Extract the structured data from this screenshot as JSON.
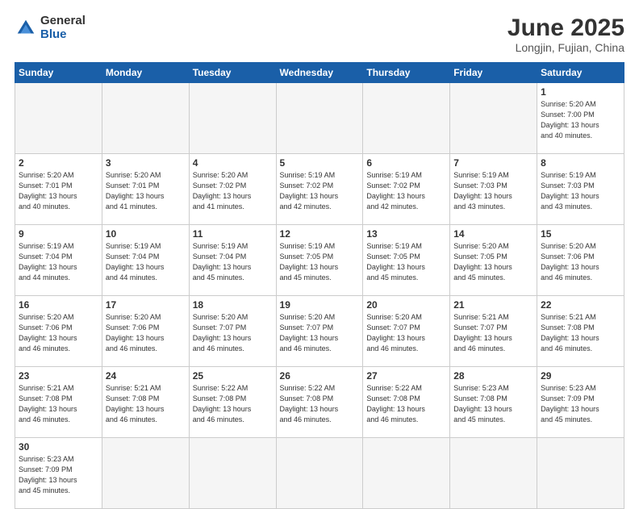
{
  "logo": {
    "general": "General",
    "blue": "Blue"
  },
  "title": "June 2025",
  "subtitle": "Longjin, Fujian, China",
  "headers": [
    "Sunday",
    "Monday",
    "Tuesday",
    "Wednesday",
    "Thursday",
    "Friday",
    "Saturday"
  ],
  "days": [
    {
      "num": "",
      "info": ""
    },
    {
      "num": "",
      "info": ""
    },
    {
      "num": "",
      "info": ""
    },
    {
      "num": "",
      "info": ""
    },
    {
      "num": "",
      "info": ""
    },
    {
      "num": "",
      "info": ""
    },
    {
      "num": "1",
      "info": "Sunrise: 5:20 AM\nSunset: 7:00 PM\nDaylight: 13 hours\nand 40 minutes."
    },
    {
      "num": "2",
      "info": "Sunrise: 5:20 AM\nSunset: 7:01 PM\nDaylight: 13 hours\nand 40 minutes."
    },
    {
      "num": "3",
      "info": "Sunrise: 5:20 AM\nSunset: 7:01 PM\nDaylight: 13 hours\nand 41 minutes."
    },
    {
      "num": "4",
      "info": "Sunrise: 5:20 AM\nSunset: 7:02 PM\nDaylight: 13 hours\nand 41 minutes."
    },
    {
      "num": "5",
      "info": "Sunrise: 5:19 AM\nSunset: 7:02 PM\nDaylight: 13 hours\nand 42 minutes."
    },
    {
      "num": "6",
      "info": "Sunrise: 5:19 AM\nSunset: 7:02 PM\nDaylight: 13 hours\nand 42 minutes."
    },
    {
      "num": "7",
      "info": "Sunrise: 5:19 AM\nSunset: 7:03 PM\nDaylight: 13 hours\nand 43 minutes."
    },
    {
      "num": "8",
      "info": "Sunrise: 5:19 AM\nSunset: 7:03 PM\nDaylight: 13 hours\nand 43 minutes."
    },
    {
      "num": "9",
      "info": "Sunrise: 5:19 AM\nSunset: 7:04 PM\nDaylight: 13 hours\nand 44 minutes."
    },
    {
      "num": "10",
      "info": "Sunrise: 5:19 AM\nSunset: 7:04 PM\nDaylight: 13 hours\nand 44 minutes."
    },
    {
      "num": "11",
      "info": "Sunrise: 5:19 AM\nSunset: 7:04 PM\nDaylight: 13 hours\nand 45 minutes."
    },
    {
      "num": "12",
      "info": "Sunrise: 5:19 AM\nSunset: 7:05 PM\nDaylight: 13 hours\nand 45 minutes."
    },
    {
      "num": "13",
      "info": "Sunrise: 5:19 AM\nSunset: 7:05 PM\nDaylight: 13 hours\nand 45 minutes."
    },
    {
      "num": "14",
      "info": "Sunrise: 5:20 AM\nSunset: 7:05 PM\nDaylight: 13 hours\nand 45 minutes."
    },
    {
      "num": "15",
      "info": "Sunrise: 5:20 AM\nSunset: 7:06 PM\nDaylight: 13 hours\nand 46 minutes."
    },
    {
      "num": "16",
      "info": "Sunrise: 5:20 AM\nSunset: 7:06 PM\nDaylight: 13 hours\nand 46 minutes."
    },
    {
      "num": "17",
      "info": "Sunrise: 5:20 AM\nSunset: 7:06 PM\nDaylight: 13 hours\nand 46 minutes."
    },
    {
      "num": "18",
      "info": "Sunrise: 5:20 AM\nSunset: 7:07 PM\nDaylight: 13 hours\nand 46 minutes."
    },
    {
      "num": "19",
      "info": "Sunrise: 5:20 AM\nSunset: 7:07 PM\nDaylight: 13 hours\nand 46 minutes."
    },
    {
      "num": "20",
      "info": "Sunrise: 5:20 AM\nSunset: 7:07 PM\nDaylight: 13 hours\nand 46 minutes."
    },
    {
      "num": "21",
      "info": "Sunrise: 5:21 AM\nSunset: 7:07 PM\nDaylight: 13 hours\nand 46 minutes."
    },
    {
      "num": "22",
      "info": "Sunrise: 5:21 AM\nSunset: 7:08 PM\nDaylight: 13 hours\nand 46 minutes."
    },
    {
      "num": "23",
      "info": "Sunrise: 5:21 AM\nSunset: 7:08 PM\nDaylight: 13 hours\nand 46 minutes."
    },
    {
      "num": "24",
      "info": "Sunrise: 5:21 AM\nSunset: 7:08 PM\nDaylight: 13 hours\nand 46 minutes."
    },
    {
      "num": "25",
      "info": "Sunrise: 5:22 AM\nSunset: 7:08 PM\nDaylight: 13 hours\nand 46 minutes."
    },
    {
      "num": "26",
      "info": "Sunrise: 5:22 AM\nSunset: 7:08 PM\nDaylight: 13 hours\nand 46 minutes."
    },
    {
      "num": "27",
      "info": "Sunrise: 5:22 AM\nSunset: 7:08 PM\nDaylight: 13 hours\nand 46 minutes."
    },
    {
      "num": "28",
      "info": "Sunrise: 5:23 AM\nSunset: 7:08 PM\nDaylight: 13 hours\nand 45 minutes."
    },
    {
      "num": "29",
      "info": "Sunrise: 5:23 AM\nSunset: 7:09 PM\nDaylight: 13 hours\nand 45 minutes."
    },
    {
      "num": "30",
      "info": "Sunrise: 5:23 AM\nSunset: 7:09 PM\nDaylight: 13 hours\nand 45 minutes."
    },
    {
      "num": "",
      "info": ""
    },
    {
      "num": "",
      "info": ""
    },
    {
      "num": "",
      "info": ""
    },
    {
      "num": "",
      "info": ""
    },
    {
      "num": "",
      "info": ""
    }
  ]
}
